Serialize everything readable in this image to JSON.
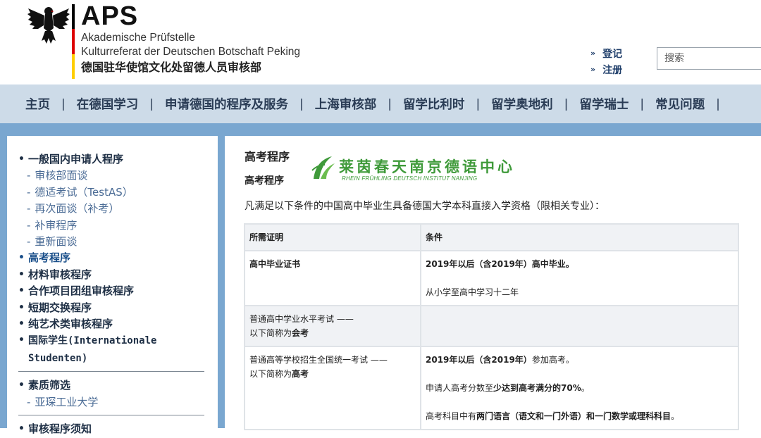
{
  "header": {
    "logo_title": "APS",
    "logo_line1": "Akademische Prüfstelle",
    "logo_line2": "Kulturreferat der Deutschen Botschaft Peking",
    "logo_line3": "德国驻华使馆文化处留德人员审核部",
    "login_label": "登记",
    "register_label": "注册",
    "search_placeholder": "搜索",
    "arrow": "»"
  },
  "nav": {
    "separator": "|",
    "items": [
      "主页",
      "在德国学习",
      "申请德国的程序及服务",
      "上海审核部",
      "留学比利时",
      "留学奥地利",
      "留学瑞士",
      "常见问题"
    ]
  },
  "sidebar": {
    "bullet": "•",
    "dash": "-",
    "group1_title": "一般国内申请人程序",
    "group1_subs": [
      "审核部面谈",
      "德适考试（TestAS）",
      "再次面谈（补考）",
      "补审程序",
      "重新面谈"
    ],
    "items": [
      "高考程序",
      "材料审核程序",
      "合作项目团组审核程序",
      "短期交换程序",
      "纯艺术类审核程序"
    ],
    "international_line1": "国际学生(Internationale",
    "international_line2": "Studenten)",
    "group2_title": "素质筛选",
    "group2_subs": [
      "亚琛工业大学"
    ],
    "last_item": "审核程序须知"
  },
  "main": {
    "page_title": "高考程序",
    "section_title": "高考程序",
    "partner_cn": "莱茵春天南京德语中心",
    "partner_de": "RHEIN FRÜHLING DEUTSCH INSTITUT NANJING",
    "intro": "凡满足以下条件的中国高中毕业生具备德国大学本科直接入学资格（限相关专业）：",
    "table": {
      "headers": [
        "所需证明",
        "条件"
      ],
      "row1": {
        "proof": "高中毕业证书",
        "cond1": "2019年以后（含2019年）高中毕业。",
        "cond2": "从小学至高中学习十二年"
      },
      "row2": {
        "proof_line1": "普通高中学业水平考试 ——",
        "proof_line2_prefix": "以下简称为",
        "proof_line2_bold": "会考"
      },
      "row3": {
        "proof_line1": "普通高等学校招生全国统一考试 ——",
        "proof_line2_prefix": "以下简称为",
        "proof_line2_bold": "高考",
        "cond1_bold": "2019年以后（含2019年）",
        "cond1_rest": "参加高考。",
        "cond2_prefix": "申请人高考分数至",
        "cond2_bold": "少达到高考满分的70%",
        "cond2_end": "。",
        "cond3_prefix": "高考科目中有",
        "cond3_bold": "两门语言（语文和一门外语）和一门数学或理科科目",
        "cond3_end": "。"
      }
    }
  }
}
